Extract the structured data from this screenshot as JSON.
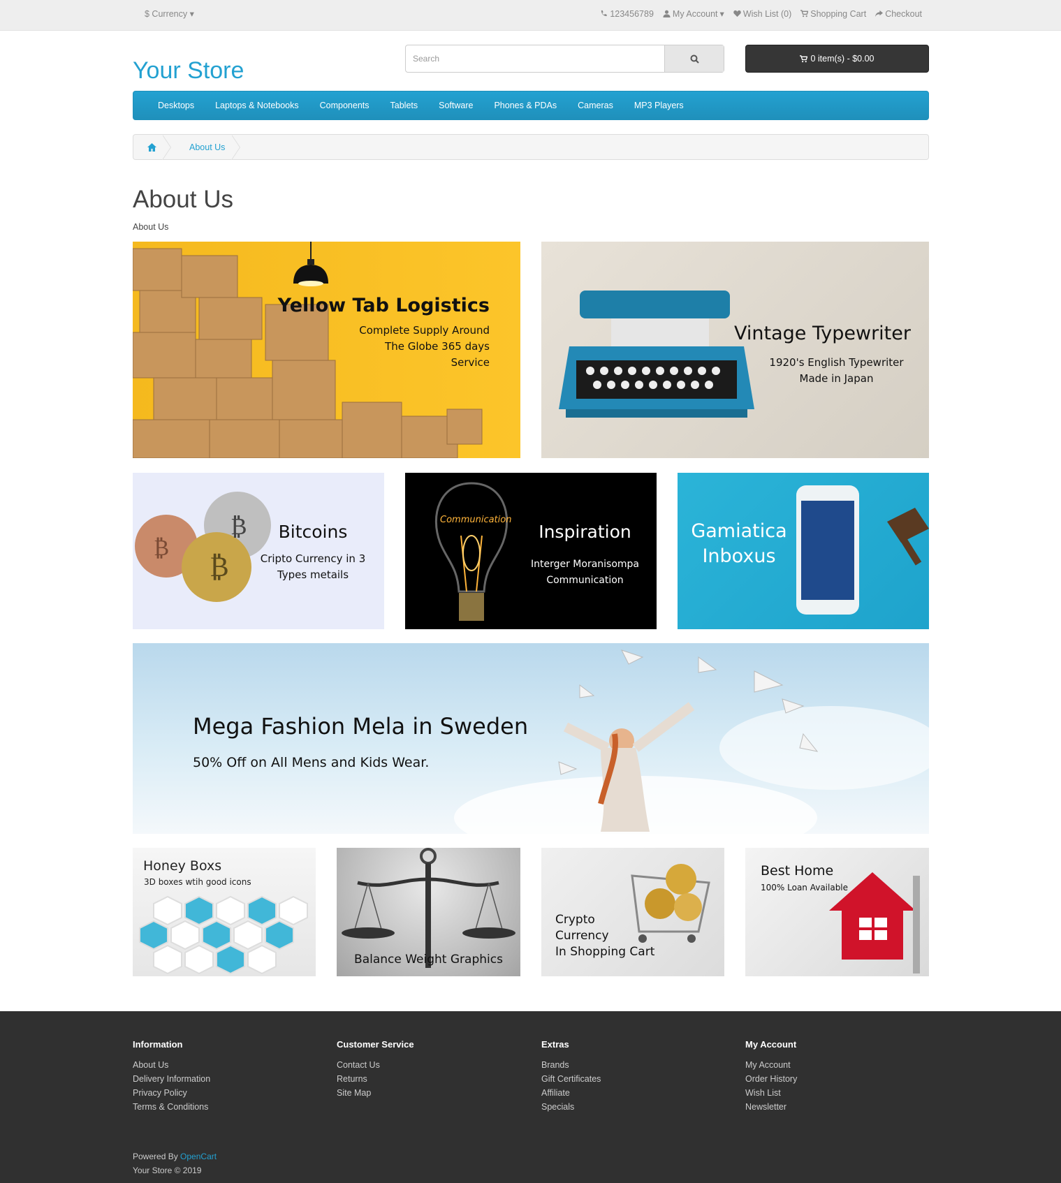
{
  "topbar": {
    "currency": "$ Currency",
    "phone": "123456789",
    "my_account": "My Account",
    "wish_list": "Wish List (0)",
    "shopping_cart": "Shopping Cart",
    "checkout": "Checkout"
  },
  "header": {
    "logo": "Your Store",
    "search_placeholder": "Search",
    "cart": "0 item(s) - $0.00"
  },
  "menu": [
    "Desktops",
    "Laptops & Notebooks",
    "Components",
    "Tablets",
    "Software",
    "Phones & PDAs",
    "Cameras",
    "MP3 Players"
  ],
  "breadcrumb": {
    "current": "About Us"
  },
  "page": {
    "title": "About Us",
    "subtitle": "About Us"
  },
  "banners": {
    "b1": {
      "title": "Yellow Tab Logistics",
      "l1": "Complete Supply Around",
      "l2": "The Globe 365 days",
      "l3": "Service"
    },
    "b2": {
      "title": "Vintage Typewriter",
      "l1": "1920's English Typewriter",
      "l2": "Made in Japan"
    },
    "b3": {
      "title": "Bitcoins",
      "l1": "Cripto Currency in 3",
      "l2": "Types metails"
    },
    "b4": {
      "title": "Inspiration",
      "l1": "Interger Moranisompa",
      "l2": "Communication",
      "glow": "Communication"
    },
    "b5": {
      "l1": "Gamiatica",
      "l2": "Inboxus"
    },
    "b6": {
      "title": "Mega Fashion Mela in Sweden",
      "l1": "50% Off on All Mens and Kids Wear."
    },
    "b7": {
      "title": "Honey Boxs",
      "l1": "3D boxes wtih good icons"
    },
    "b8": {
      "title": "Balance Weight Graphics"
    },
    "b9": {
      "l1": "Crypto",
      "l2": "Currency",
      "l3": "In Shopping Cart"
    },
    "b10": {
      "title": "Best Home",
      "l1": "100% Loan Available"
    }
  },
  "footer": {
    "information": {
      "title": "Information",
      "items": [
        "About Us",
        "Delivery Information",
        "Privacy Policy",
        "Terms & Conditions"
      ]
    },
    "customer_service": {
      "title": "Customer Service",
      "items": [
        "Contact Us",
        "Returns",
        "Site Map"
      ]
    },
    "extras": {
      "title": "Extras",
      "items": [
        "Brands",
        "Gift Certificates",
        "Affiliate",
        "Specials"
      ]
    },
    "my_account": {
      "title": "My Account",
      "items": [
        "My Account",
        "Order History",
        "Wish List",
        "Newsletter"
      ]
    },
    "powered_prefix": "Powered By",
    "powered_link": "OpenCart",
    "copyright": "Your Store © 2019"
  }
}
